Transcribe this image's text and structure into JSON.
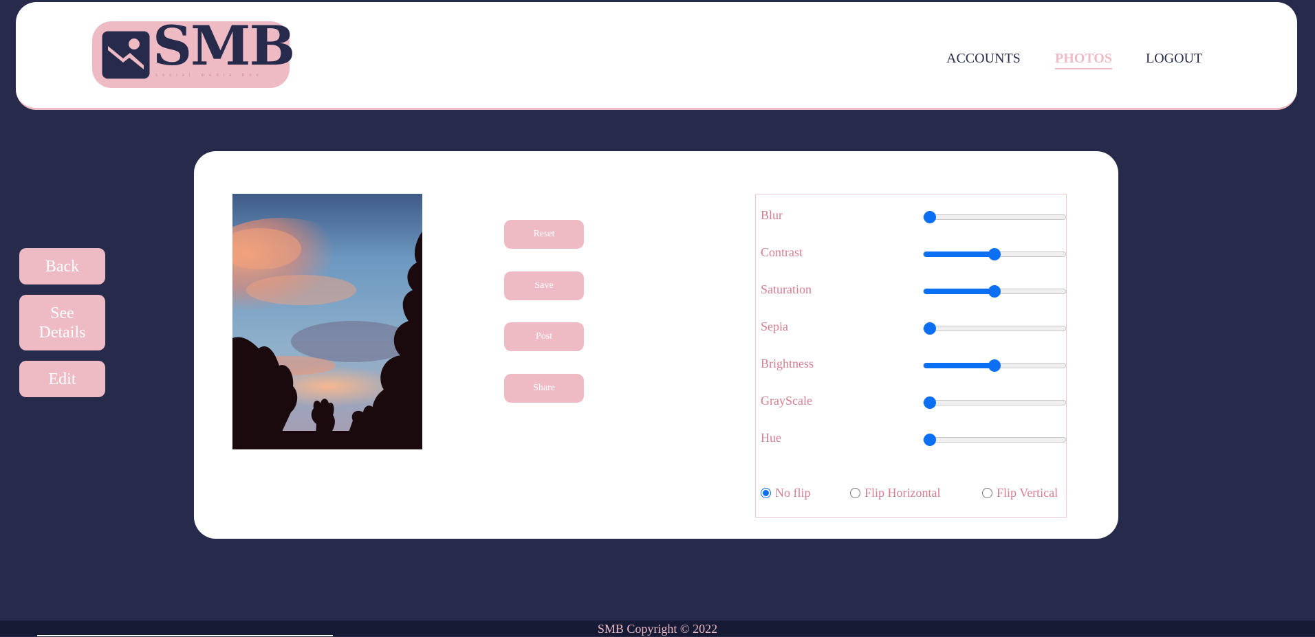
{
  "brand": {
    "name": "SMB",
    "tagline": "social media box",
    "colors": {
      "accent": "#eebbc4",
      "navy": "#262a4b",
      "slider": "#0a6ff2",
      "label": "#d47e90"
    }
  },
  "nav": {
    "items": [
      {
        "label": "ACCOUNTS",
        "active": false
      },
      {
        "label": "PHOTOS",
        "active": true
      },
      {
        "label": "LOGOUT",
        "active": false
      }
    ]
  },
  "sidebar": {
    "back_label": "Back",
    "details_label": "See Details",
    "edit_label": "Edit"
  },
  "photo": {
    "alt": "Sunset sky over silhouetted trees"
  },
  "actions": {
    "reset_label": "Reset",
    "save_label": "Save",
    "post_label": "Post",
    "share_label": "Share"
  },
  "filters": {
    "items": [
      {
        "label": "Blur",
        "value": 0
      },
      {
        "label": "Contrast",
        "value": 0.5
      },
      {
        "label": "Saturation",
        "value": 0.5
      },
      {
        "label": "Sepia",
        "value": 0
      },
      {
        "label": "Brightness",
        "value": 0.5
      },
      {
        "label": "GrayScale",
        "value": 0
      },
      {
        "label": "Hue",
        "value": 0
      }
    ],
    "flip": {
      "options": [
        "No flip",
        "Flip Horizontal",
        "Flip Vertical"
      ],
      "selected": "No flip"
    }
  },
  "footer": {
    "text": "SMB Copyright © 2022"
  }
}
